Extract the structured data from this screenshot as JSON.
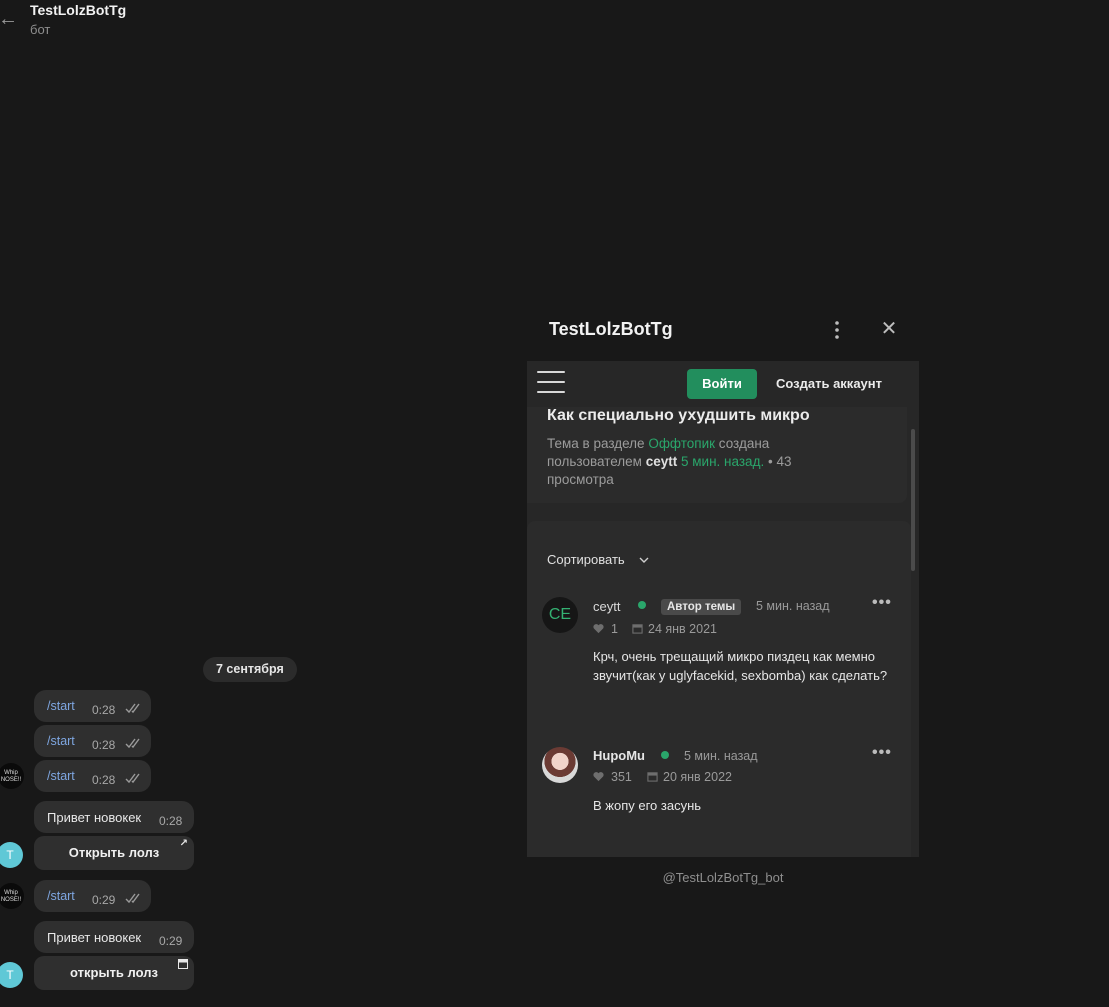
{
  "header": {
    "title": "TestLolzBotTg",
    "subtitle": "бот"
  },
  "date_pill": "7 сентября",
  "messages": {
    "start1": {
      "cmd": "/start",
      "time": "0:28"
    },
    "start2": {
      "cmd": "/start",
      "time": "0:28"
    },
    "start3": {
      "cmd": "/start",
      "time": "0:28"
    },
    "greet1": {
      "text": "Привет новокек",
      "time": "0:28",
      "button": "Открыть лолз"
    },
    "start4": {
      "cmd": "/start",
      "time": "0:29"
    },
    "greet2": {
      "text": "Привет новокек",
      "time": "0:29",
      "button": "открыть лолз"
    }
  },
  "avatars": {
    "bot_letter": "T",
    "user_text": "Whip NOSE!!"
  },
  "webapp": {
    "title": "TestLolzBotTg",
    "footer": "@TestLolzBotTg_bot",
    "login": "Войти",
    "register": "Создать аккаунт",
    "topic": {
      "title": "Как специально ухудшить микро",
      "meta_prefix": "Тема в разделе",
      "section": "Оффтопик",
      "meta_mid": "создана пользователем",
      "author": "ceytt",
      "time": "5 мин. назад.",
      "views": "• 43 просмотра"
    },
    "sort": "Сортировать",
    "posts": [
      {
        "avatar": "CE",
        "user": "ceytt",
        "badge": "Автор темы",
        "time": "5 мин. назад",
        "likes": "1",
        "date": "24 янв 2021",
        "text": "Крч, очень трещащий микро пиздец как мемно звучит(как у uglyfacekid, sexbomba) как сделать?"
      },
      {
        "user": "HupoMu",
        "time": "5 мин. назад",
        "likes": "351",
        "date": "20 янв 2022",
        "text": "В жопу его засунь"
      }
    ]
  },
  "colors": {
    "accent_green": "#228e5d",
    "link_green": "#2aa66b",
    "bubble": "#2f2f2f",
    "command_blue": "#7ea6e0"
  }
}
